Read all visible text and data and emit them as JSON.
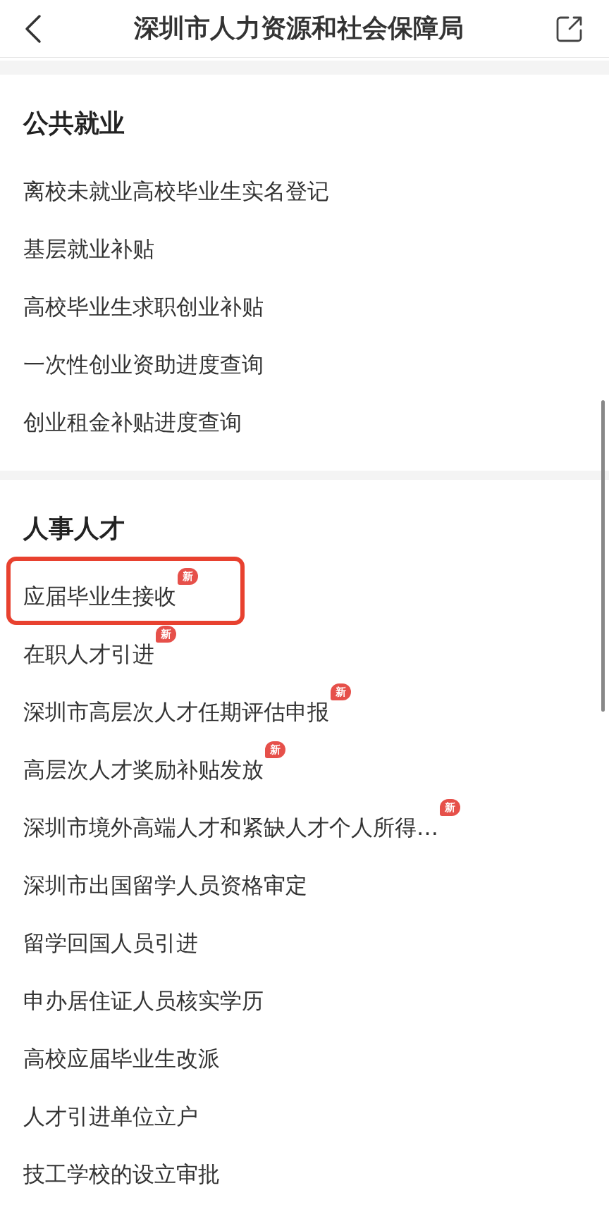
{
  "header": {
    "title": "深圳市人力资源和社会保障局"
  },
  "sections": [
    {
      "title": "公共就业",
      "items": [
        {
          "label": "离校未就业高校毕业生实名登记",
          "highlighted": false
        },
        {
          "label": "基层就业补贴",
          "highlighted": false
        },
        {
          "label": "高校毕业生求职创业补贴",
          "highlighted": false
        },
        {
          "label": "一次性创业资助进度查询",
          "highlighted": false
        },
        {
          "label": "创业租金补贴进度查询",
          "highlighted": false
        }
      ]
    },
    {
      "title": "人事人才",
      "items": [
        {
          "label": "应届毕业生接收",
          "badge": "新",
          "highlighted": true
        },
        {
          "label": "在职人才引进",
          "badge": "新",
          "highlighted": false
        },
        {
          "label": "深圳市高层次人才任期评估申报",
          "badge": "新",
          "highlighted": false
        },
        {
          "label": "高层次人才奖励补贴发放",
          "badge": "新",
          "highlighted": false
        },
        {
          "label": "深圳市境外高端人才和紧缺人才个人所得…",
          "badge": "新",
          "highlighted": false
        },
        {
          "label": "深圳市出国留学人员资格审定",
          "highlighted": false
        },
        {
          "label": "留学回国人员引进",
          "highlighted": false
        },
        {
          "label": "申办居住证人员核实学历",
          "highlighted": false
        },
        {
          "label": "高校应届毕业生改派",
          "highlighted": false
        },
        {
          "label": "人才引进单位立户",
          "highlighted": false
        },
        {
          "label": "技工学校的设立审批",
          "highlighted": false
        }
      ]
    }
  ]
}
